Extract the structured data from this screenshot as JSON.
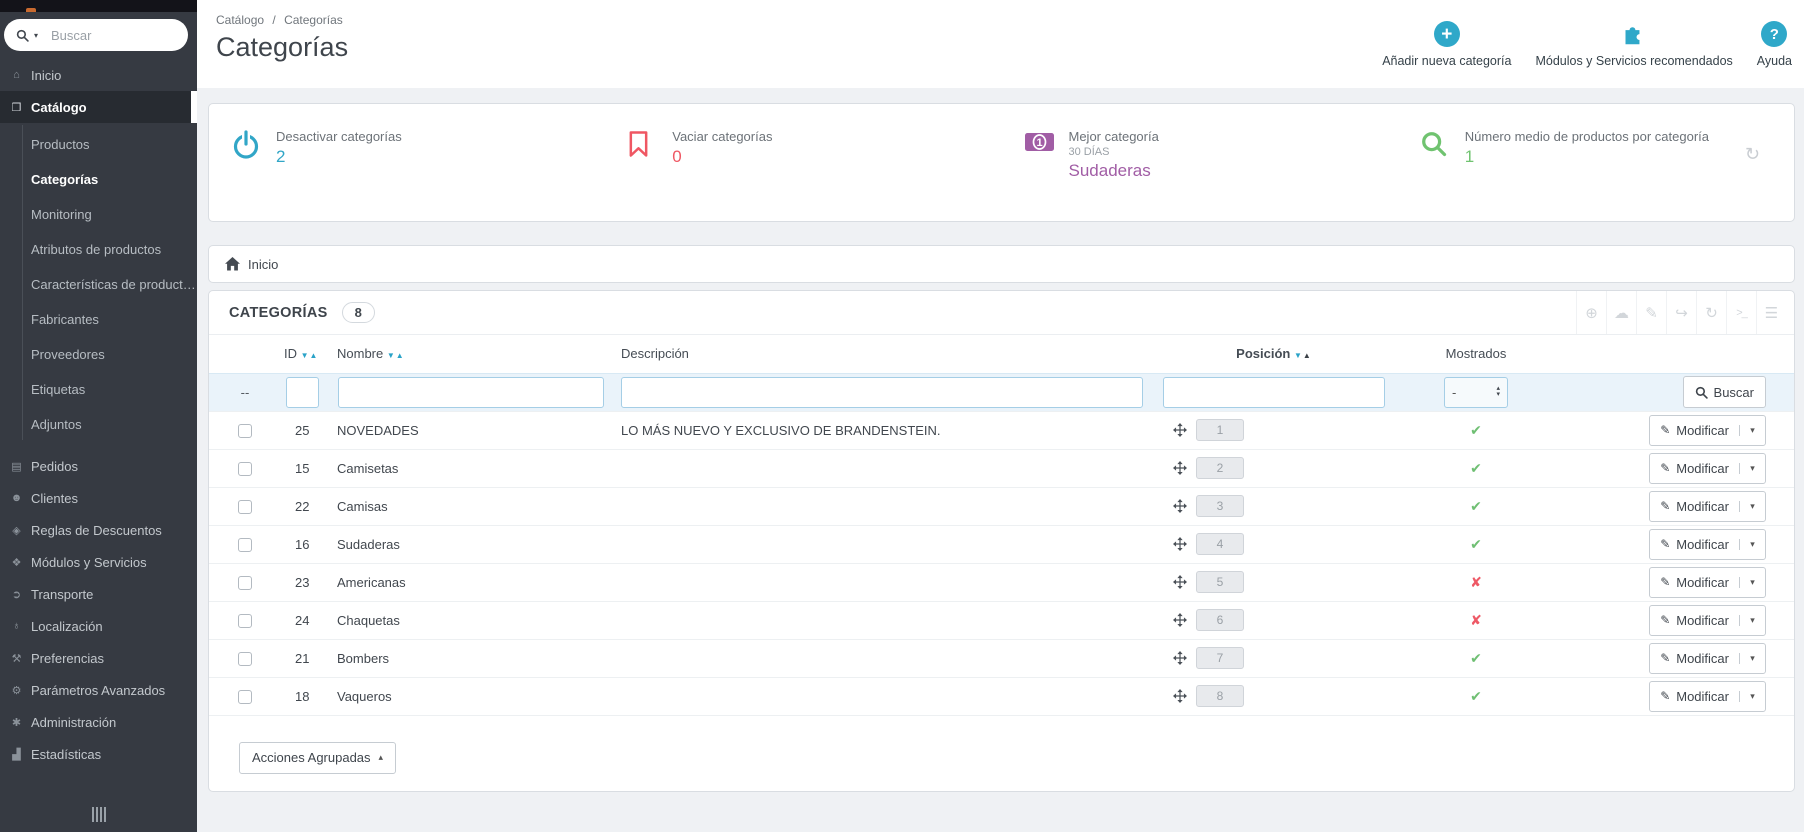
{
  "colors": {
    "accent_blue": "#2fa8c9",
    "red": "#ef5763",
    "purple": "#a15da5",
    "green": "#70c370",
    "sidebar_bg": "#363a42"
  },
  "icons": {
    "search_caret": "▾",
    "sort_desc": "▼",
    "sort_asc": "▲",
    "caret_down": "▾",
    "caret_up": "▴",
    "pencil": "✎",
    "refresh": "↻",
    "plus": "+",
    "question": "?"
  },
  "sidebar": {
    "search": {
      "placeholder": "Buscar"
    },
    "items": [
      {
        "label": "Inicio",
        "icon": "⌂"
      },
      {
        "label": "Catálogo",
        "icon": "❒"
      },
      {
        "label": "Pedidos",
        "icon": "▤"
      },
      {
        "label": "Clientes",
        "icon": "☻"
      },
      {
        "label": "Reglas de Descuentos",
        "icon": "◈"
      },
      {
        "label": "Módulos y Servicios",
        "icon": "❖"
      },
      {
        "label": "Transporte",
        "icon": "➲"
      },
      {
        "label": "Localización",
        "icon": "♁"
      },
      {
        "label": "Preferencias",
        "icon": "⚒"
      },
      {
        "label": "Parámetros Avanzados",
        "icon": "⚙"
      },
      {
        "label": "Administración",
        "icon": "✱"
      },
      {
        "label": "Estadísticas",
        "icon": "▟"
      }
    ],
    "catalog_children": [
      {
        "label": "Productos"
      },
      {
        "label": "Categorías"
      },
      {
        "label": "Monitoring"
      },
      {
        "label": "Atributos de productos"
      },
      {
        "label": "Características de product…"
      },
      {
        "label": "Fabricantes"
      },
      {
        "label": "Proveedores"
      },
      {
        "label": "Etiquetas"
      },
      {
        "label": "Adjuntos"
      }
    ]
  },
  "header": {
    "breadcrumb": {
      "parent": "Catálogo",
      "separator": "/",
      "current": "Categorías"
    },
    "title": "Categorías",
    "actions": [
      {
        "label": "Añadir nueva categoría"
      },
      {
        "label": "Módulos y Servicios recomendados"
      },
      {
        "label": "Ayuda"
      }
    ]
  },
  "kpis": [
    {
      "label": "Desactivar categorías",
      "value": "2"
    },
    {
      "label": "Vaciar categorías",
      "value": "0"
    },
    {
      "label": "Mejor categoría",
      "sublabel": "30 DÍAS",
      "value": "Sudaderas"
    },
    {
      "label": "Número medio de productos por categoría",
      "value": "1"
    }
  ],
  "home_bar": {
    "label": "Inicio"
  },
  "panel": {
    "title": "CATEGORÍAS",
    "count": "8",
    "toolbar": [
      {
        "glyph": "⊕"
      },
      {
        "glyph": "☁"
      },
      {
        "glyph": "✎"
      },
      {
        "glyph": "↪"
      },
      {
        "glyph": "↻"
      },
      {
        "glyph": ">_"
      },
      {
        "glyph": "☰"
      }
    ],
    "columns": {
      "id": "ID",
      "name": "Nombre",
      "description": "Descripción",
      "position": "Posición",
      "shown": "Mostrados"
    },
    "filter": {
      "empty": "--",
      "select_value": "-",
      "search_label": "Buscar"
    },
    "rows": [
      {
        "id": "25",
        "name": "NOVEDADES",
        "description": "LO MÁS NUEVO Y EXCLUSIVO DE BRANDENSTEIN.",
        "position": "1",
        "shown_glyph": "✔",
        "shown_class": "mark ok"
      },
      {
        "id": "15",
        "name": "Camisetas",
        "description": "",
        "position": "2",
        "shown_glyph": "✔",
        "shown_class": "mark ok"
      },
      {
        "id": "22",
        "name": "Camisas",
        "description": "",
        "position": "3",
        "shown_glyph": "✔",
        "shown_class": "mark ok"
      },
      {
        "id": "16",
        "name": "Sudaderas",
        "description": "",
        "position": "4",
        "shown_glyph": "✔",
        "shown_class": "mark ok"
      },
      {
        "id": "23",
        "name": "Americanas",
        "description": "",
        "position": "5",
        "shown_glyph": "✘",
        "shown_class": "mark no"
      },
      {
        "id": "24",
        "name": "Chaquetas",
        "description": "",
        "position": "6",
        "shown_glyph": "✘",
        "shown_class": "mark no"
      },
      {
        "id": "21",
        "name": "Bombers",
        "description": "",
        "position": "7",
        "shown_glyph": "✔",
        "shown_class": "mark ok"
      },
      {
        "id": "18",
        "name": "Vaqueros",
        "description": "",
        "position": "8",
        "shown_glyph": "✔",
        "shown_class": "mark ok"
      }
    ],
    "row_action": {
      "label": "Modificar"
    },
    "grouped_actions": {
      "label": "Acciones Agrupadas"
    }
  }
}
